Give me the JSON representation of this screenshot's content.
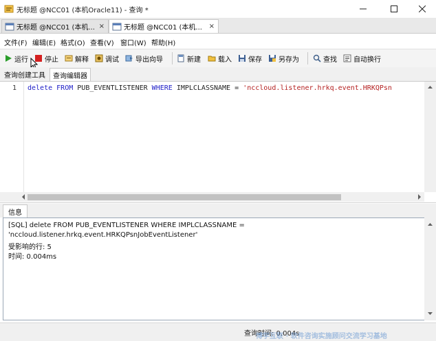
{
  "window": {
    "title": "无标题 @NCC01 (本机Oracle11) - 查询 *",
    "controls": [
      "minimize",
      "maximize",
      "close"
    ]
  },
  "doc_tabs": [
    {
      "label": "无标题 @NCC01 (本机...",
      "close": "×",
      "active": false
    },
    {
      "label": "无标题 @NCC01 (本机...",
      "close": "×",
      "active": true
    }
  ],
  "menu": [
    "文件(F)",
    "编辑(E)",
    "格式(O)",
    "查看(V)",
    "窗口(W)",
    "帮助(H)"
  ],
  "toolbar": {
    "run": "运行",
    "stop": "停止",
    "explain": "解释",
    "debug": "调试",
    "export_wizard": "导出向导",
    "new": "新建",
    "load": "载入",
    "save": "保存",
    "save_as": "另存为",
    "find": "查找",
    "word_wrap": "自动换行"
  },
  "sub_tabs": [
    "查询创建工具",
    "查询编辑器"
  ],
  "editor": {
    "line_number": "1",
    "tokens": {
      "kw_delete": "delete",
      "kw_from": "FROM",
      "table": "PUB_EVENTLISTENER",
      "kw_where": "WHERE",
      "column": "IMPLCLASSNAME",
      "op": "=",
      "value": "'nccloud.listener.hrkq.event.HRKQPsn"
    }
  },
  "info": {
    "tab_label": "信息",
    "lines": [
      "[SQL] delete FROM PUB_EVENTLISTENER WHERE IMPLCLASSNAME =",
      "'nccloud.listener.hrkq.event.HRKQPsnJobEventListener'",
      "受影响的行: 5",
      "时间: 0.004ms"
    ]
  },
  "status": {
    "query_time": "查询时间: 0.004s",
    "watermark": "博学互联 · 软件咨询实施顾问交流学习基地"
  },
  "colors": {
    "keyword": "#2020c8",
    "string": "#b42020",
    "run_icon": "#2a9d2a",
    "stop_icon": "#d42020"
  }
}
